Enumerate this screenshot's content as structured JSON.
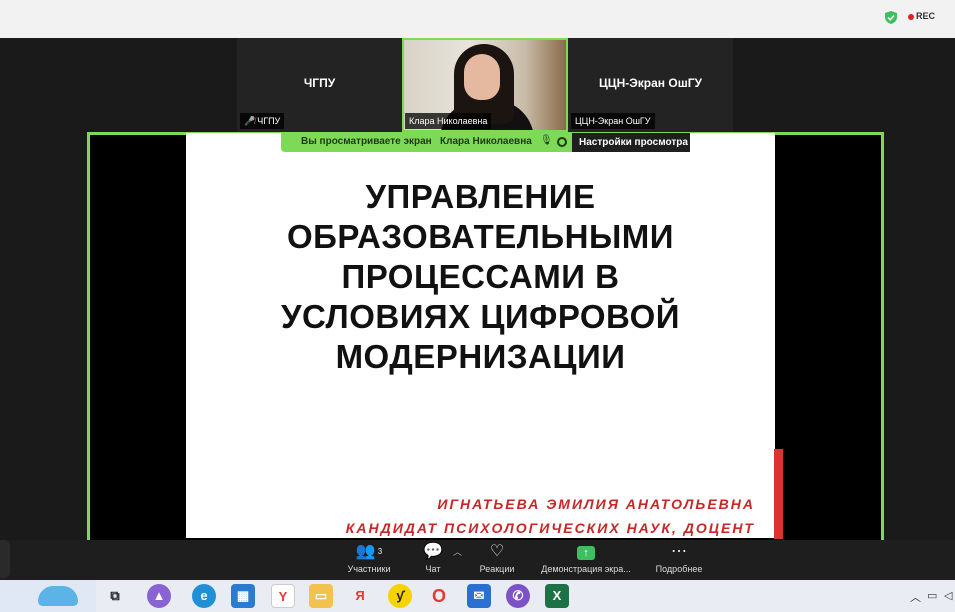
{
  "top": {
    "rec_label": "REC"
  },
  "participants": [
    {
      "name": "ЧГПУ",
      "label": "ЧГПУ",
      "muted": true
    },
    {
      "name": "Клара Николаевна",
      "label": "Клара Николаевна",
      "muted": false
    },
    {
      "name": "ЦЦН-Экран ОшГУ",
      "label": "ЦЦН-Экран ОшГУ",
      "muted": false
    }
  ],
  "share": {
    "viewing_text": "Вы просматриваете экран",
    "sharer_name": "Клара Николаевна",
    "settings_label": "Настройки просмотра"
  },
  "slide": {
    "title_lines": [
      "УПРАВЛЕНИЕ",
      "ОБРАЗОВАТЕЛЬНЫМИ",
      "ПРОЦЕССАМИ В",
      "УСЛОВИЯХ ЦИФРОВОЙ",
      "МОДЕРНИЗАЦИИ"
    ],
    "author": "ИГНАТЬЕВА ЭМИЛИЯ АНАТОЛЬЕВНА",
    "degree": "КАНДИДАТ ПСИХОЛОГИЧЕСКИХ НАУК, ДОЦЕНТ"
  },
  "toolbar": {
    "participants_label": "Участники",
    "participants_count": "3",
    "chat_label": "Чат",
    "reactions_label": "Реакции",
    "share_label": "Демонстрация экра...",
    "more_label": "Подробнее"
  },
  "colors": {
    "accent": "#7ed957",
    "slide_red": "#c62828",
    "rec": "#e02020"
  }
}
